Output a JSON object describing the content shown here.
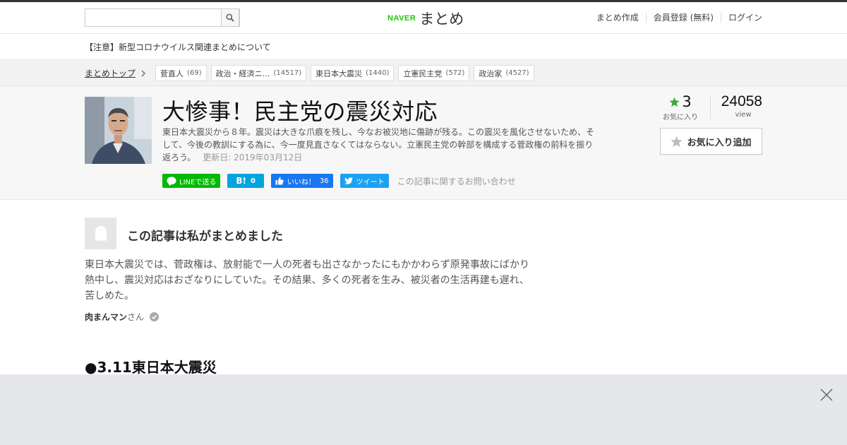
{
  "header": {
    "search_placeholder": "",
    "logo_naver": "NAVER",
    "logo_matome": "まとめ",
    "nav": [
      "まとめ作成",
      "会員登録 (無料)",
      "ログイン"
    ]
  },
  "notice": "【注意】新型コロナウイルス関連まとめについて",
  "breadcrumb": {
    "home": "まとめトップ",
    "tags": [
      {
        "label": "菅直人",
        "count": "(69)"
      },
      {
        "label": "政治・経済ニ…",
        "count": "(14517)"
      },
      {
        "label": "東日本大震災",
        "count": "(1440)"
      },
      {
        "label": "立憲民主党",
        "count": "(572)"
      },
      {
        "label": "政治家",
        "count": "(4527)"
      }
    ]
  },
  "article": {
    "title": "大惨事！民主党の震災対応",
    "description": "東日本大震災から８年。震災は大きな爪痕を残し、今なお被災地に傷跡が残る。この震災を風化させないため、そして、今後の教訓にする為に、今一度見直さなくてはならない。立憲民主党の幹部を構成する菅政権の前科を振り返ろう。",
    "updated": "更新日: 2019年03月12日",
    "share": {
      "line": "LINEで送る",
      "hatena_count": "0",
      "like": "いいね！",
      "like_count": "36",
      "tweet": "ツイート",
      "inquiry": "この記事に関するお問い合わせ"
    },
    "stats": {
      "fav_count": "3",
      "fav_label": "お気に入り",
      "view_count": "24058",
      "view_label": "view"
    },
    "fav_button": "お気に入り追加"
  },
  "author": {
    "heading": "この記事は私がまとめました",
    "comment": "東日本大震災では、菅政権は、放射能で一人の死者も出さなかったにもかかわらず原発事故にばかり熱中し、震災対応はおざなりにしていた。その結果、多くの死者を生み、被災者の生活再建も遅れ、苦しめた。",
    "name": "肉まんマン",
    "suffix": "さん"
  },
  "section_title": "●3.11東日本大震災",
  "colors": {
    "naver_green": "#1ec800",
    "line_green": "#00b900",
    "hatena_blue": "#00a4de",
    "facebook_blue": "#1877f2",
    "twitter_blue": "#1da1f2",
    "star_green": "#3aaa35"
  }
}
